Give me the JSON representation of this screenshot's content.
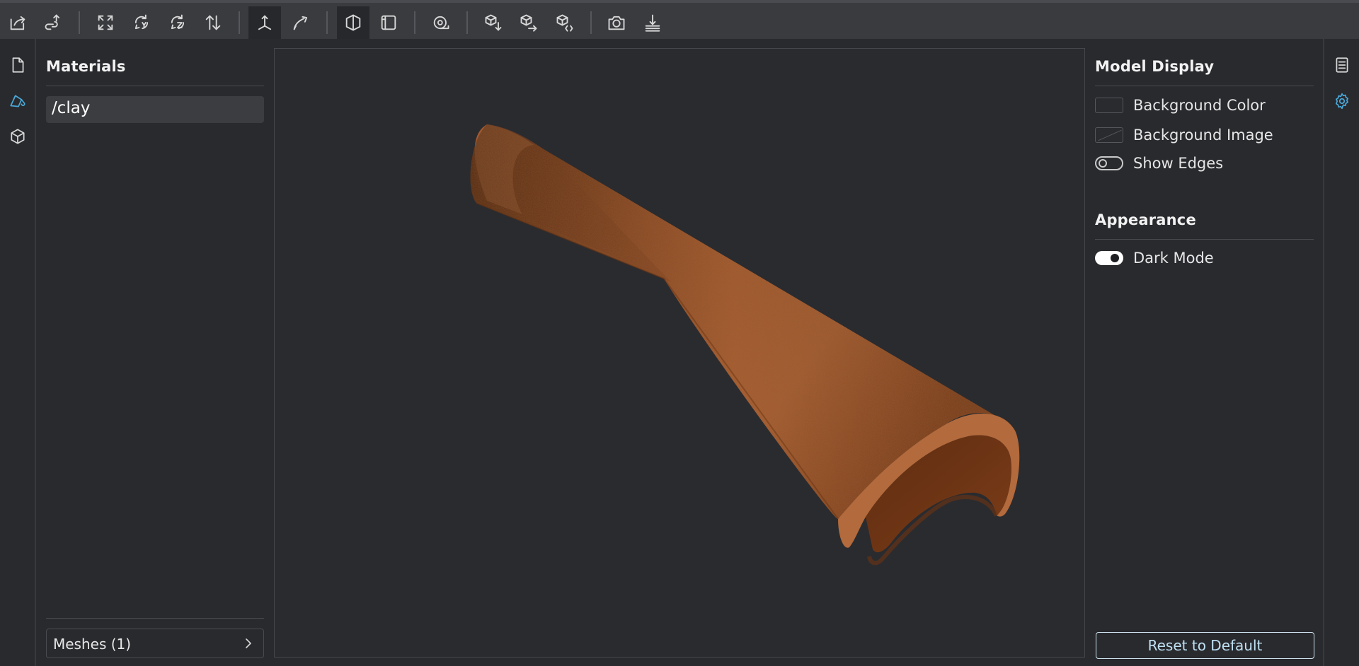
{
  "toolbar": {
    "buttons": [
      {
        "icon": "open-file-icon"
      },
      {
        "icon": "share-link-icon"
      },
      {
        "icon": "fit-view-icon"
      },
      {
        "icon": "rotate-y-icon"
      },
      {
        "icon": "rotate-z-icon"
      },
      {
        "icon": "flip-up-down-icon"
      },
      {
        "icon": "up-axis-icon",
        "active": true
      },
      {
        "icon": "measure-curve-icon"
      },
      {
        "icon": "shaded-view-icon",
        "active": true
      },
      {
        "icon": "box-view-icon"
      },
      {
        "icon": "tape-measure-icon"
      },
      {
        "icon": "cube-down-icon"
      },
      {
        "icon": "cube-right-icon"
      },
      {
        "icon": "cube-code-icon"
      },
      {
        "icon": "camera-icon"
      },
      {
        "icon": "ground-plane-icon"
      }
    ]
  },
  "left_strip": {
    "items": [
      {
        "icon": "file-icon"
      },
      {
        "icon": "materials-icon",
        "active": true
      },
      {
        "icon": "cube-icon"
      }
    ]
  },
  "left_panel": {
    "title": "Materials",
    "materials": [
      "/clay"
    ],
    "meshes_label": "Meshes (1)"
  },
  "right_panel": {
    "model_display_title": "Model Display",
    "background_color_label": "Background Color",
    "background_image_label": "Background Image",
    "show_edges_label": "Show Edges",
    "show_edges": false,
    "appearance_title": "Appearance",
    "dark_mode_label": "Dark Mode",
    "dark_mode": true,
    "reset_label": "Reset to Default"
  },
  "right_strip": {
    "items": [
      {
        "icon": "document-list-icon"
      },
      {
        "icon": "settings-icon",
        "active": true
      }
    ]
  },
  "colors": {
    "accent": "#4aa8d8",
    "clay": "#9a5229",
    "background": "#292a2e",
    "toolbar": "#3a3b3f"
  }
}
